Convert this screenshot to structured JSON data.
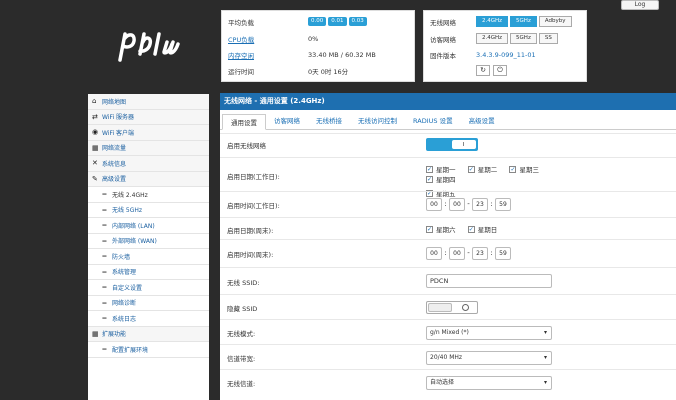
{
  "header": {
    "logout_label": "Log"
  },
  "status_left": [
    {
      "label": "平均负载",
      "badges": [
        "0.00",
        "0.01",
        "0.03"
      ]
    },
    {
      "label": "CPU负载",
      "value": "0%"
    },
    {
      "label": "内存空闲",
      "value": "33.40 MB / 60.32 MB"
    },
    {
      "label": "运行时间",
      "value": "0天 0时 16分"
    }
  ],
  "status_right": {
    "wireless_label": "无线网络",
    "wireless_options": [
      "2.4GHz",
      "5GHz",
      "Adbyby"
    ],
    "access_label": "访客网络",
    "access_options": [
      "2.4GHz",
      "5GHz",
      "SS"
    ],
    "firmware_label": "固件版本",
    "firmware_value": "3.4.3.9-099_11-01"
  },
  "sidebar": {
    "items": [
      {
        "icon": "⌂",
        "label": "网络地图",
        "sub": false
      },
      {
        "icon": "⇄",
        "label": "WiFi 服务器",
        "sub": false
      },
      {
        "icon": "◉",
        "label": "WiFi 客户端",
        "sub": false
      },
      {
        "icon": "▦",
        "label": "网络流量",
        "sub": false
      },
      {
        "icon": "✕",
        "label": "系统信息",
        "sub": false
      },
      {
        "icon": "✎",
        "label": "高级设置",
        "sub": false
      },
      {
        "icon": "‒",
        "label": "无线 2.4GHz",
        "sub": true,
        "active": true
      },
      {
        "icon": "‒",
        "label": "无线 5GHz",
        "sub": true
      },
      {
        "icon": "‒",
        "label": "内部网络 (LAN)",
        "sub": true
      },
      {
        "icon": "‒",
        "label": "外部网络 (WAN)",
        "sub": true
      },
      {
        "icon": "‒",
        "label": "防火墙",
        "sub": true
      },
      {
        "icon": "‒",
        "label": "系统管理",
        "sub": true
      },
      {
        "icon": "‒",
        "label": "自定义设置",
        "sub": true
      },
      {
        "icon": "‒",
        "label": "网络诊断",
        "sub": true
      },
      {
        "icon": "‒",
        "label": "系统日志",
        "sub": true
      },
      {
        "icon": "▦",
        "label": "扩展功能",
        "sub": false
      },
      {
        "icon": "‒",
        "label": "配置扩展环境",
        "sub": true
      }
    ]
  },
  "main": {
    "title": "无线网络 - 通用设置 (2.4GHz)",
    "tabs": [
      "通用设置",
      "访客网络",
      "无线桥接",
      "无线访问控制",
      "RADIUS 设置",
      "高级设置"
    ],
    "fields": {
      "enable_wireless": "启用无线网络",
      "enable_days_work": "启用日期(工作日):",
      "days_work": [
        "星期一",
        "星期二",
        "星期三",
        "星期四",
        "星期五"
      ],
      "enable_time_work": "启用时间(工作日):",
      "time_work": [
        "00",
        "00",
        "23",
        "59"
      ],
      "enable_days_weekend": "启用日期(周末):",
      "days_weekend": [
        "星期六",
        "星期日"
      ],
      "enable_time_weekend": "启用时间(周末):",
      "time_weekend": [
        "00",
        "00",
        "23",
        "59"
      ],
      "ssid_label": "无线 SSID:",
      "ssid_value": "PDCN",
      "hide_ssid": "隐藏 SSID",
      "mode_label": "无线模式:",
      "mode_value": "g/n Mixed (*)",
      "bandwidth_label": "信道带宽:",
      "bandwidth_value": "20/40 MHz",
      "channel_label": "无线信道:",
      "channel_value": "自动选择"
    }
  },
  "colors": {
    "accent": "#1e6fb0",
    "badge": "#2a9fd6",
    "background": "#2b2b2b"
  }
}
